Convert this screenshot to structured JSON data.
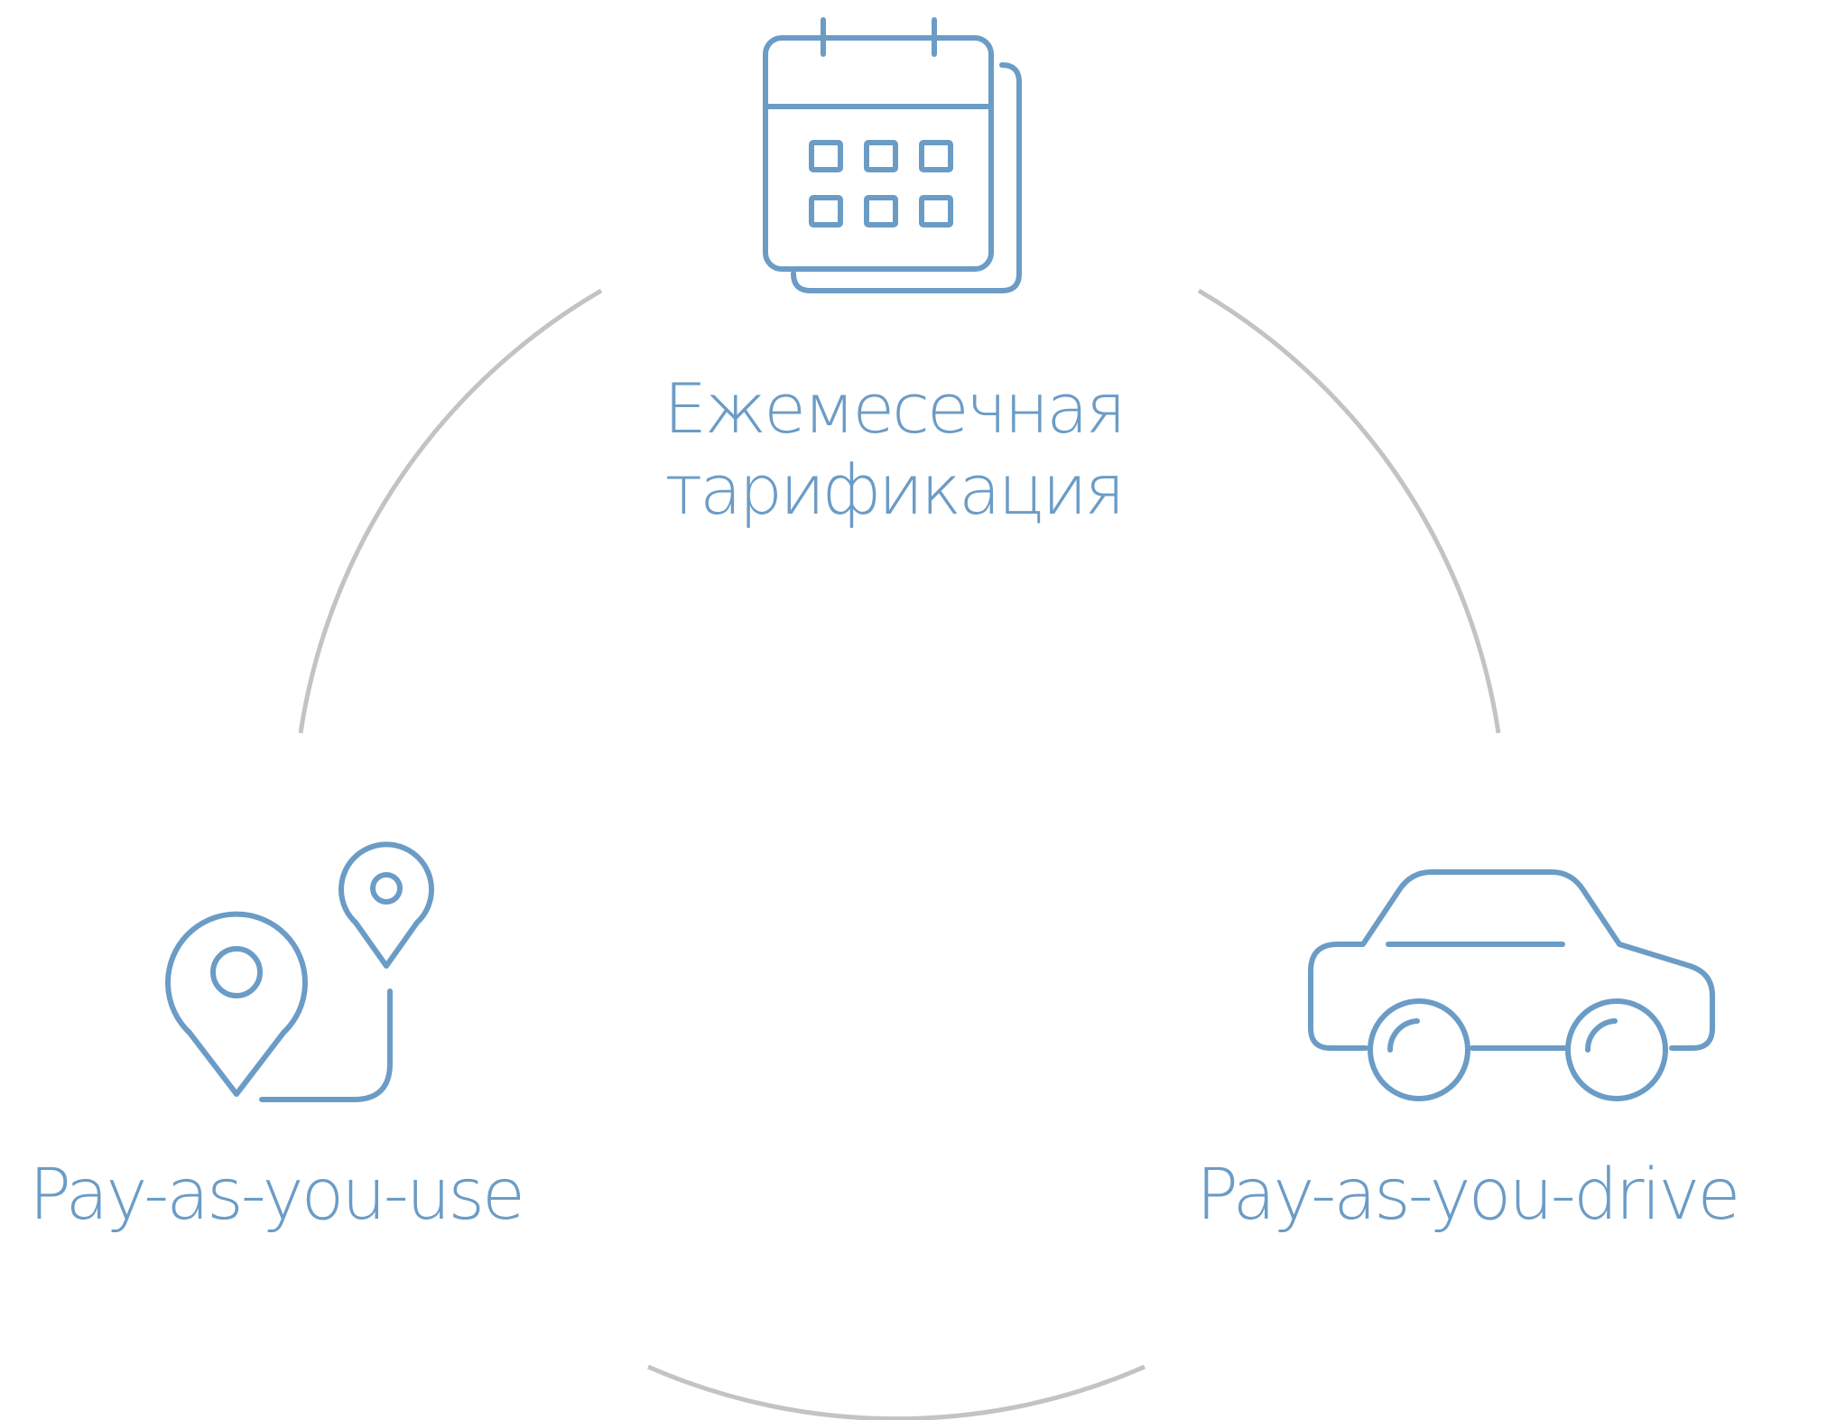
{
  "colors": {
    "accent": "#6b9cc6",
    "ring": "#c3c3c3",
    "background": "#ffffff"
  },
  "nodes": {
    "monthly": {
      "icon": "calendar-icon",
      "label_line1": "Ежемесечная",
      "label_line2": "тарификация"
    },
    "usage": {
      "icon": "route-pins-icon",
      "label": "Pay-as-you-use"
    },
    "driving": {
      "icon": "car-icon",
      "label": "Pay-as-you-drive"
    }
  }
}
